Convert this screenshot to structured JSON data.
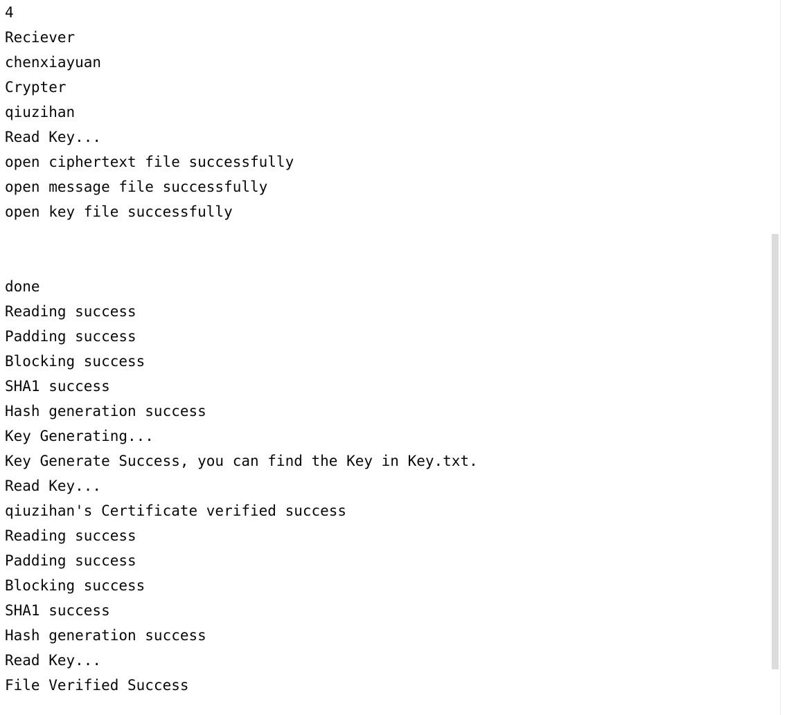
{
  "console": {
    "lines": [
      "4",
      "Reciever",
      "chenxiayuan",
      "Crypter",
      "qiuzihan",
      "Read Key...",
      "open ciphertext file successfully",
      "open message file successfully",
      "open key file successfully",
      "",
      "",
      "done",
      "Reading success",
      "Padding success",
      "Blocking success",
      "SHA1 success",
      "Hash generation success",
      "Key Generating...",
      "Key Generate Success, you can find the Key in Key.txt.",
      "Read Key...",
      "qiuzihan's Certificate verified success",
      "Reading success",
      "Padding success",
      "Blocking success",
      "SHA1 success",
      "Hash generation success",
      "Read Key...",
      "File Verified Success"
    ]
  }
}
